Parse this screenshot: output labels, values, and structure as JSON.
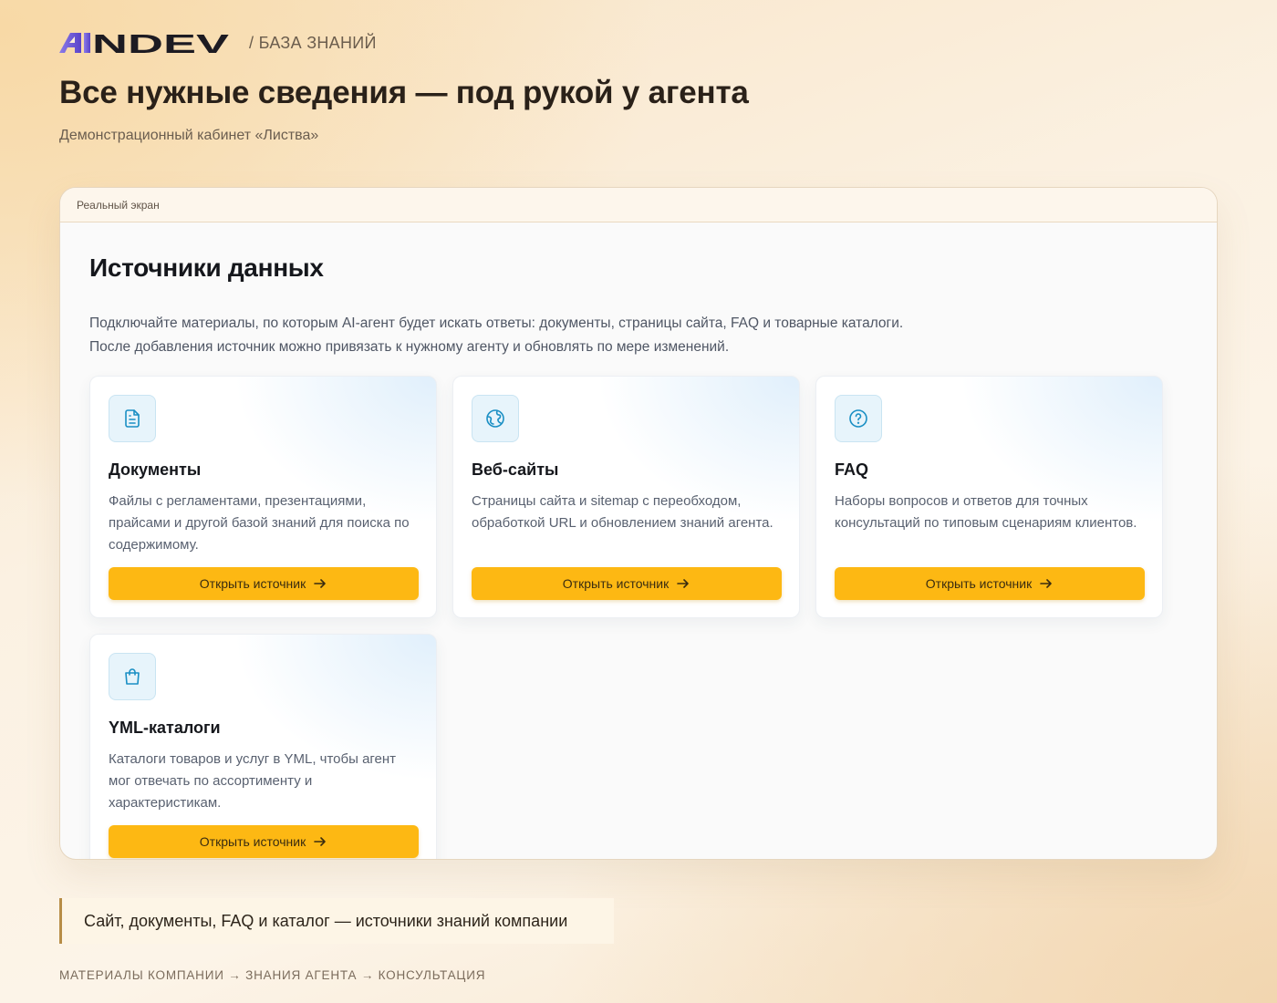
{
  "header": {
    "logo_text": "AiNDEV",
    "section": "/ БАЗА ЗНАНИЙ"
  },
  "page": {
    "title": "Все нужные сведения — под рукой у агента",
    "subtitle": "Демонстрационный кабинет «Листва»"
  },
  "frame": {
    "bar_label": "Реальный экран",
    "title": "Источники данных",
    "description": "Подключайте материалы, по которым AI-агент будет искать ответы: документы, страницы сайта, FAQ и товарные каталоги. После добавления источник можно привязать к нужному агенту и обновлять по мере изменений.",
    "cards": [
      {
        "icon": "document-icon",
        "title": "Документы",
        "text": "Файлы с регламентами, презентациями, прайсами и другой базой знаний для поиска по содержимому.",
        "button": "Открыть источник"
      },
      {
        "icon": "globe-icon",
        "title": "Веб-сайты",
        "text": "Страницы сайта и sitemap с переобходом, обработкой URL и обновлением знаний агента.",
        "button": "Открыть источник"
      },
      {
        "icon": "question-icon",
        "title": "FAQ",
        "text": "Наборы вопросов и ответов для точных консультаций по типовым сценариям клиентов.",
        "button": "Открыть источник"
      },
      {
        "icon": "shopping-bag-icon",
        "title": "YML-каталоги",
        "text": "Каталоги товаров и услуг в YML, чтобы агент мог отвечать по ассортименту и характеристикам.",
        "button": "Открыть источник"
      }
    ]
  },
  "caption": "Сайт, документы, FAQ и каталог — источники знаний компании",
  "flow": "МАТЕРИАЛЫ КОМПАНИИ → ЗНАНИЯ АГЕНТА → КОНСУЛЬТАЦИЯ",
  "colors": {
    "accent": "#fdb813",
    "logo": "#1d1b22",
    "logo_accent": "#6f5ad6",
    "icon": "#1a8fc4"
  }
}
